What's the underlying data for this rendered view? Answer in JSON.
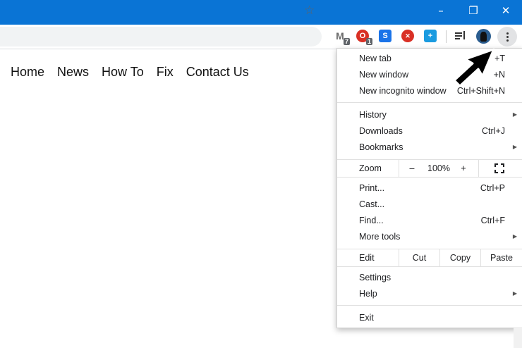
{
  "window": {
    "minimize": "–",
    "restore": "❐",
    "close": "✕"
  },
  "toolbar": {
    "star": "☆",
    "extensions": [
      {
        "name": "gmail",
        "glyph": "M",
        "color": "#6b6b6b",
        "badge": "7"
      },
      {
        "name": "opera",
        "glyph": "O",
        "color": "#d93025",
        "badge": "1"
      },
      {
        "name": "skype",
        "glyph": "S",
        "color": "#1a73e8",
        "badge": ""
      },
      {
        "name": "red-ext",
        "glyph": "✕",
        "color": "#d93025",
        "badge": ""
      },
      {
        "name": "blue-ext",
        "glyph": "+",
        "color": "#1a9be0",
        "badge": ""
      }
    ]
  },
  "nav": {
    "home": "Home",
    "news": "News",
    "howto": "How To",
    "fix": "Fix",
    "contact": "Contact Us"
  },
  "menu": {
    "new_tab": "New tab",
    "new_tab_sc": "+T",
    "new_window": "New window",
    "new_window_sc": "+N",
    "incognito": "New incognito window",
    "incognito_sc": "Ctrl+Shift+N",
    "history": "History",
    "downloads": "Downloads",
    "downloads_sc": "Ctrl+J",
    "bookmarks": "Bookmarks",
    "zoom": "Zoom",
    "zoom_minus": "–",
    "zoom_value": "100%",
    "zoom_plus": "+",
    "print": "Print...",
    "print_sc": "Ctrl+P",
    "cast": "Cast...",
    "find": "Find...",
    "find_sc": "Ctrl+F",
    "more_tools": "More tools",
    "edit": "Edit",
    "cut": "Cut",
    "copy": "Copy",
    "paste": "Paste",
    "settings": "Settings",
    "help": "Help",
    "exit": "Exit"
  }
}
